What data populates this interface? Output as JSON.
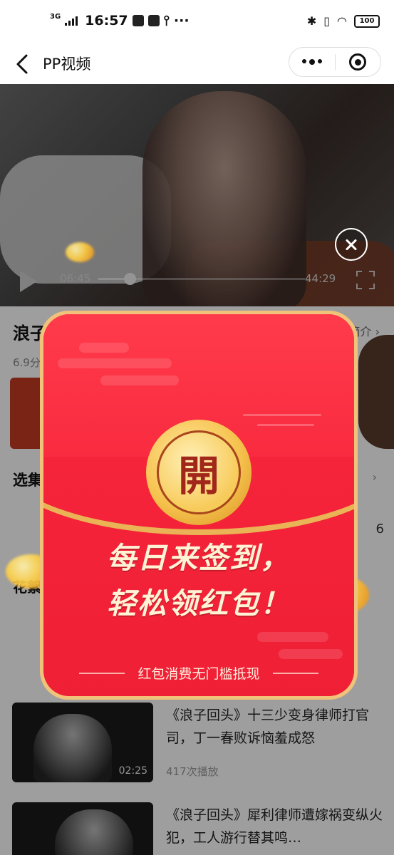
{
  "status_bar": {
    "network": "3G",
    "time": "16:57",
    "more": "···",
    "battery": "100"
  },
  "nav": {
    "title": "PP视频"
  },
  "player": {
    "current_time": "06:45",
    "total_time": "44:29",
    "progress": 0.152
  },
  "background_page": {
    "title_visible": "浪子",
    "intro_visible": "简介 ›",
    "meta_visible": "6.9分",
    "section_visible": "选集",
    "section_arrow": "›",
    "count_visible": "6",
    "hot_visible": "花絮",
    "list": [
      {
        "title": "《浪子回头》十三少变身律师打官司，丁一春败诉恼羞成怒",
        "duration": "02:25",
        "plays": "417次播放"
      },
      {
        "title": "《浪子回头》犀利律师遭嫁祸变纵火犯，工人游行替其鸣…",
        "duration": "",
        "plays": ""
      }
    ]
  },
  "red_envelope": {
    "seal": "開",
    "line1": "每日来签到，",
    "line2": "轻松领红包！",
    "footnote": "红包消费无门槛抵现"
  },
  "colors": {
    "envelope_red": "#f2283a",
    "envelope_gold": "#f0c27a",
    "seal_text": "#a2271b",
    "headline": "#fff3d6"
  }
}
